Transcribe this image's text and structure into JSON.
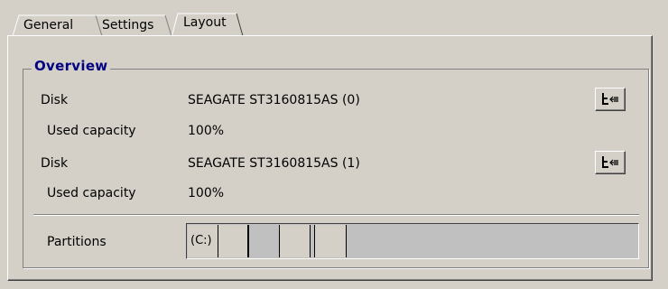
{
  "tabs": [
    {
      "label": "General",
      "active": false
    },
    {
      "label": "Settings",
      "active": false
    },
    {
      "label": "Layout",
      "active": true
    }
  ],
  "overview": {
    "title": "Overview",
    "rows": [
      {
        "label": "Disk",
        "value": "SEAGATE ST3160815AS (0)"
      },
      {
        "label": "Used capacity",
        "value": "100%"
      },
      {
        "label": "Disk",
        "value": "SEAGATE ST3160815AS (1)"
      },
      {
        "label": "Used capacity",
        "value": "100%"
      }
    ],
    "disk_button_icon": "disk-layout-icon",
    "partitions": {
      "label": "Partitions",
      "segments": [
        {
          "text": "(C:)"
        },
        {
          "text": ""
        },
        {
          "text": ""
        },
        {
          "text": ""
        },
        {
          "text": ""
        },
        {
          "text": ""
        },
        {
          "text": ""
        }
      ]
    }
  },
  "colors": {
    "background": "#d4d0c8",
    "group_title": "#000080",
    "partition_fill": "#c0c0c0"
  }
}
